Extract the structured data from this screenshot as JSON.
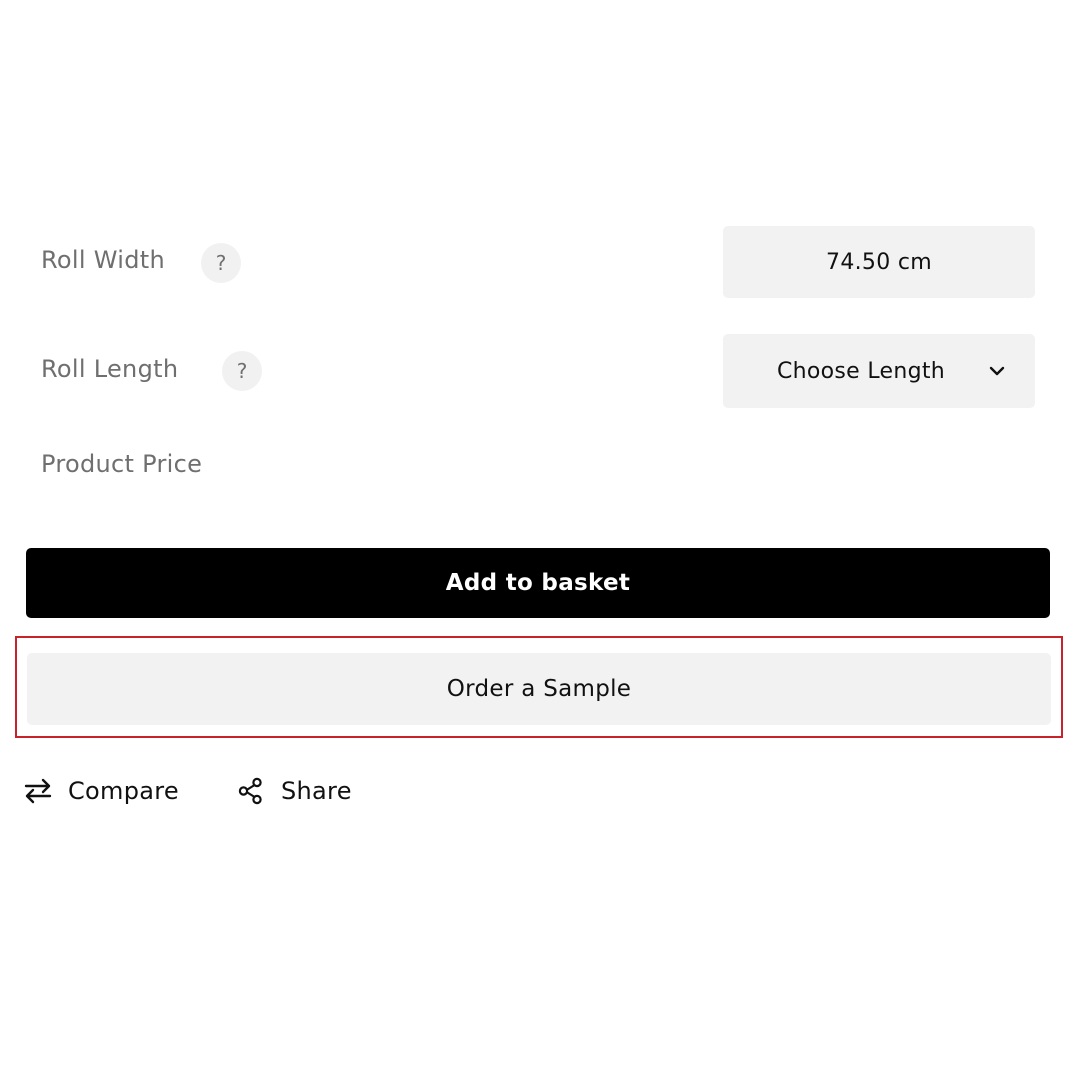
{
  "product_form": {
    "roll_width": {
      "label": "Roll Width",
      "help": "?",
      "value": "74.50 cm"
    },
    "roll_length": {
      "label": "Roll Length",
      "help": "?",
      "selected": "Choose Length",
      "icon": "chevron-down-icon"
    },
    "product_price": {
      "label": "Product Price"
    }
  },
  "buttons": {
    "add_to_basket": "Add to basket",
    "order_sample": "Order a Sample"
  },
  "actions": {
    "compare": {
      "label": "Compare",
      "icon": "compare-arrows-icon"
    },
    "share": {
      "label": "Share",
      "icon": "share-icon"
    }
  },
  "colors": {
    "primary_button": "#000000",
    "secondary_button": "#f2f2f2",
    "highlight_border": "#c8222a"
  }
}
